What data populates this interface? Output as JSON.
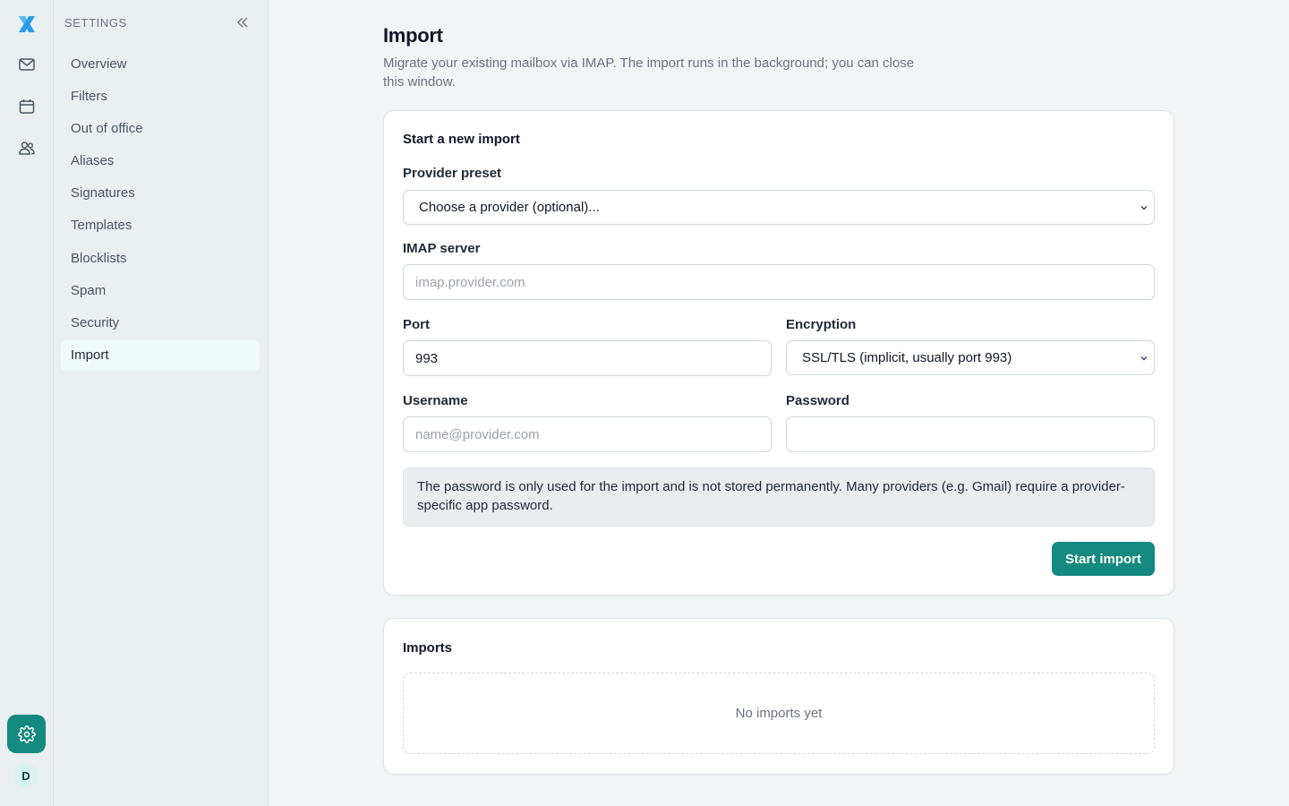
{
  "nav_title": "SETTINGS",
  "nav_items": [
    "Overview",
    "Filters",
    "Out of office",
    "Aliases",
    "Signatures",
    "Templates",
    "Blocklists",
    "Spam",
    "Security",
    "Import"
  ],
  "active_item": "Import",
  "avatar_initial": "D",
  "page": {
    "title": "Import",
    "subtitle": "Migrate your existing mailbox via IMAP. The import runs in the background; you can close this window."
  },
  "new_import": {
    "title": "Start a new import",
    "provider_label": "Provider preset",
    "provider_value": "Choose a provider (optional)...",
    "server_label": "IMAP server",
    "server_placeholder": "imap.provider.com",
    "port_label": "Port",
    "port_value": "993",
    "encryption_label": "Encryption",
    "encryption_value": "SSL/TLS (implicit, usually port 993)",
    "username_label": "Username",
    "username_placeholder": "name@provider.com",
    "password_label": "Password",
    "password_value": "",
    "note": "The password is only used for the import and is not stored permanently. Many providers (e.g. Gmail) require a provider-specific app password.",
    "submit_label": "Start import"
  },
  "imports": {
    "title": "Imports",
    "empty_text": "No imports yet"
  },
  "colors": {
    "accent": "#14897f",
    "active_bg": "#f0fbf9",
    "background": "#f1f5f6",
    "logo": "#2b9de8"
  },
  "icons": [
    "app-logo-icon",
    "mail-icon",
    "calendar-icon",
    "users-icon",
    "gear-icon",
    "chevrons-left-icon",
    "chevron-down-icon"
  ]
}
